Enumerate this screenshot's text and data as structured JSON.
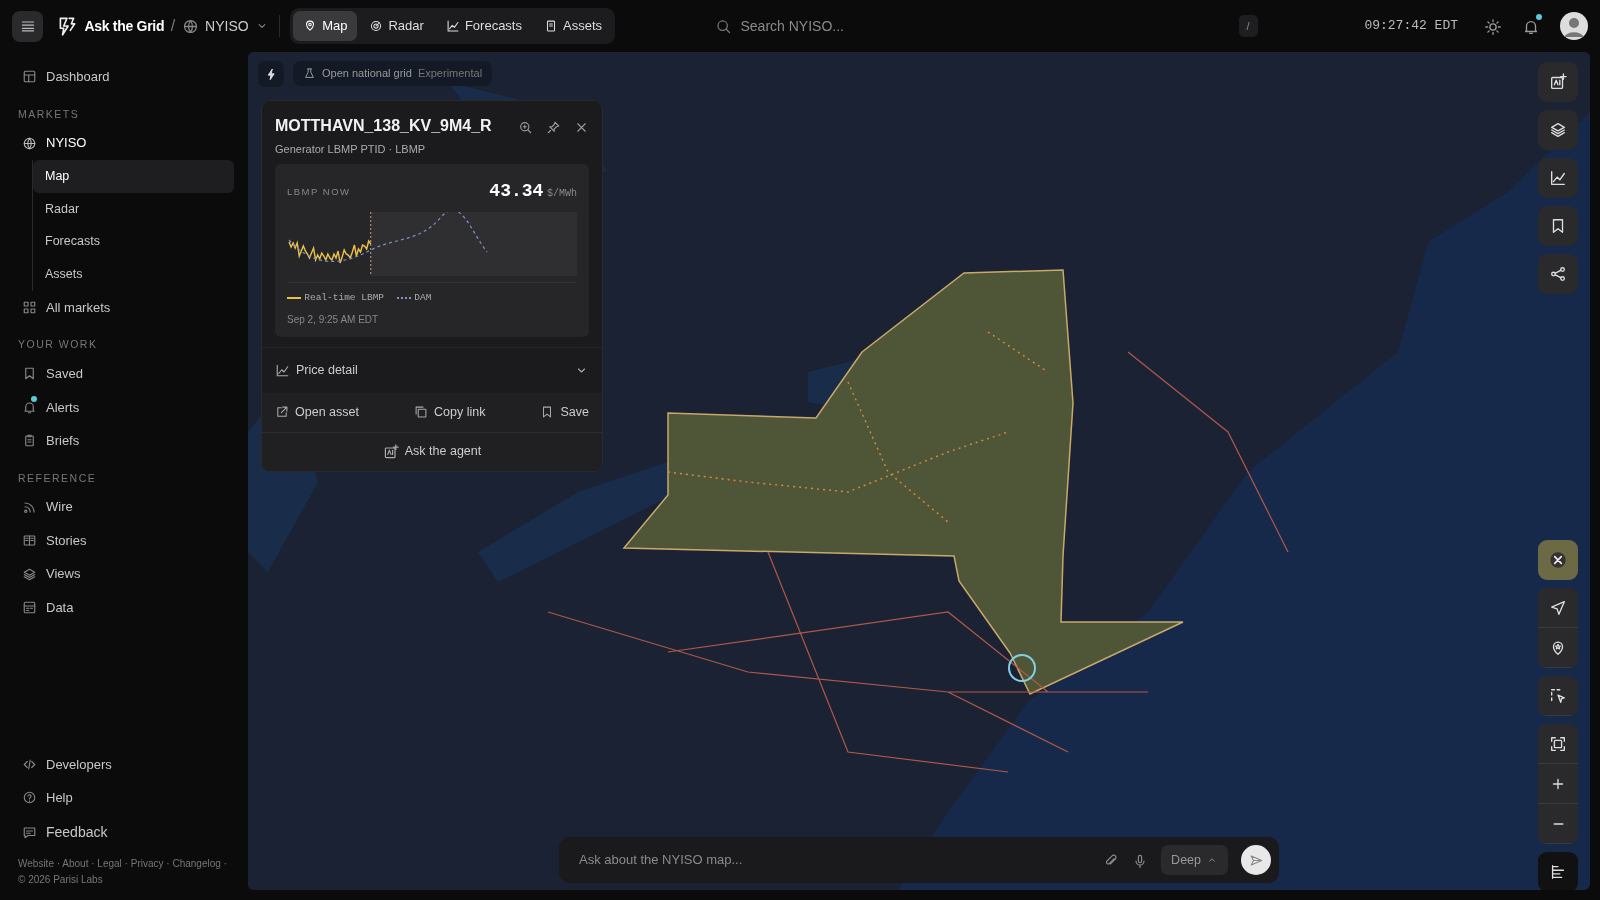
{
  "topbar": {
    "brand": "Ask the Grid",
    "separator": "/",
    "market": "NYISO",
    "tabs": [
      {
        "label": "Map",
        "selected": true
      },
      {
        "label": "Radar",
        "selected": false
      },
      {
        "label": "Forecasts",
        "selected": false
      },
      {
        "label": "Assets",
        "selected": false
      }
    ],
    "search": {
      "placeholder": "Search NYISO..."
    },
    "shortcut": "/",
    "clock": "09:27:42 EDT",
    "notifications_unread": true
  },
  "sidebar": {
    "sections": [
      {
        "items": [
          {
            "label": "Dashboard"
          }
        ]
      },
      {
        "heading": "MARKETS",
        "items": [
          {
            "label": "NYISO",
            "children": [
              {
                "label": "Map",
                "selected": true
              },
              {
                "label": "Radar",
                "selected": false
              },
              {
                "label": "Forecasts",
                "selected": false
              },
              {
                "label": "Assets",
                "selected": false
              }
            ]
          },
          {
            "label": "All markets"
          }
        ]
      },
      {
        "heading": "YOUR WORK",
        "items": [
          {
            "label": "Saved",
            "unread": false
          },
          {
            "label": "Alerts",
            "unread": true
          },
          {
            "label": "Briefs",
            "unread": false
          }
        ]
      },
      {
        "heading": "REFERENCE",
        "items": [
          {
            "label": "Wire"
          },
          {
            "label": "Stories"
          },
          {
            "label": "Views"
          },
          {
            "label": "Data"
          }
        ]
      }
    ],
    "bottom": [
      {
        "label": "Developers"
      },
      {
        "label": "Help"
      },
      {
        "label": "Feedback"
      }
    ],
    "footer": {
      "links": [
        "Website",
        "About",
        "Legal",
        "Privacy",
        "Changelog"
      ],
      "separator": "·",
      "copyright": "© 2026 Parisi Labs"
    }
  },
  "map": {
    "grid_toggle": {
      "label": "Open national grid",
      "tag": "Experimental"
    },
    "card": {
      "title": "MOTTHAVN_138_KV_9M4_R",
      "subtitle": "Generator LBMP PTID · LBMP",
      "price_label": "LBMP NOW",
      "price": "43.34",
      "unit": "$/MWh",
      "legend": [
        {
          "label": "Real-time LBMP",
          "color": "#e8c04a"
        },
        {
          "label": "DAM",
          "color": "#8090c8"
        }
      ],
      "timestamp": "Sep 2, 9:25 AM EDT",
      "detail": {
        "label": "Price detail",
        "expanded": false
      },
      "actions": [
        "Open asset",
        "Copy link",
        "Save"
      ],
      "agent": "Ask the agent"
    },
    "chat": {
      "placeholder": "Ask about the NYISO map...",
      "mode": "Deep"
    }
  }
}
